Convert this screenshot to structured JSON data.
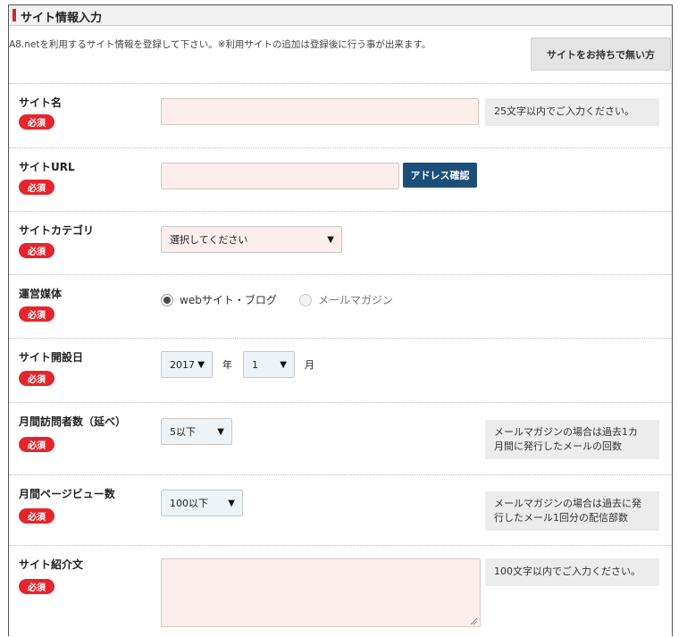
{
  "header": {
    "title": "サイト情報入力"
  },
  "intro": "A8.netを利用するサイト情報を登録して下さい。※利用サイトの追加は登録後に行う事が出来ます。",
  "no_site_button": "サイトをお持ちで無い方",
  "required_badge": "必須",
  "fields": {
    "site_name": {
      "label": "サイト名",
      "value": "",
      "hint": "25文字以内でご入力ください。"
    },
    "site_url": {
      "label": "サイトURL",
      "value": "",
      "check_button": "アドレス確認"
    },
    "category": {
      "label": "サイトカテゴリ",
      "selected": "選択してください"
    },
    "media": {
      "label": "運営媒体",
      "options": [
        "webサイト・ブログ",
        "メールマガジン"
      ],
      "selected_index": 0
    },
    "open_date": {
      "label": "サイト開設日",
      "year": "2017",
      "year_unit": "年",
      "month": "1",
      "month_unit": "月"
    },
    "visitors": {
      "label": "月間訪問者数（延べ）",
      "selected": "5以下",
      "hint_line1": "メールマガジンの場合は過去1カ",
      "hint_line2": "月間に発行したメールの回数"
    },
    "pageviews": {
      "label": "月間ページビュー数",
      "selected": "100以下",
      "hint_line1": "メールマガジンの場合は過去に発",
      "hint_line2": "行したメール1回分の配信部数"
    },
    "intro_text": {
      "label": "サイト紹介文",
      "value": "",
      "hint": "100文字以内でご入力ください。"
    }
  },
  "colors": {
    "required_badge": "#e5252c",
    "accent_bar": "#d7262d",
    "input_bg": "#fdeeee",
    "address_button": "#1b4f7a"
  }
}
